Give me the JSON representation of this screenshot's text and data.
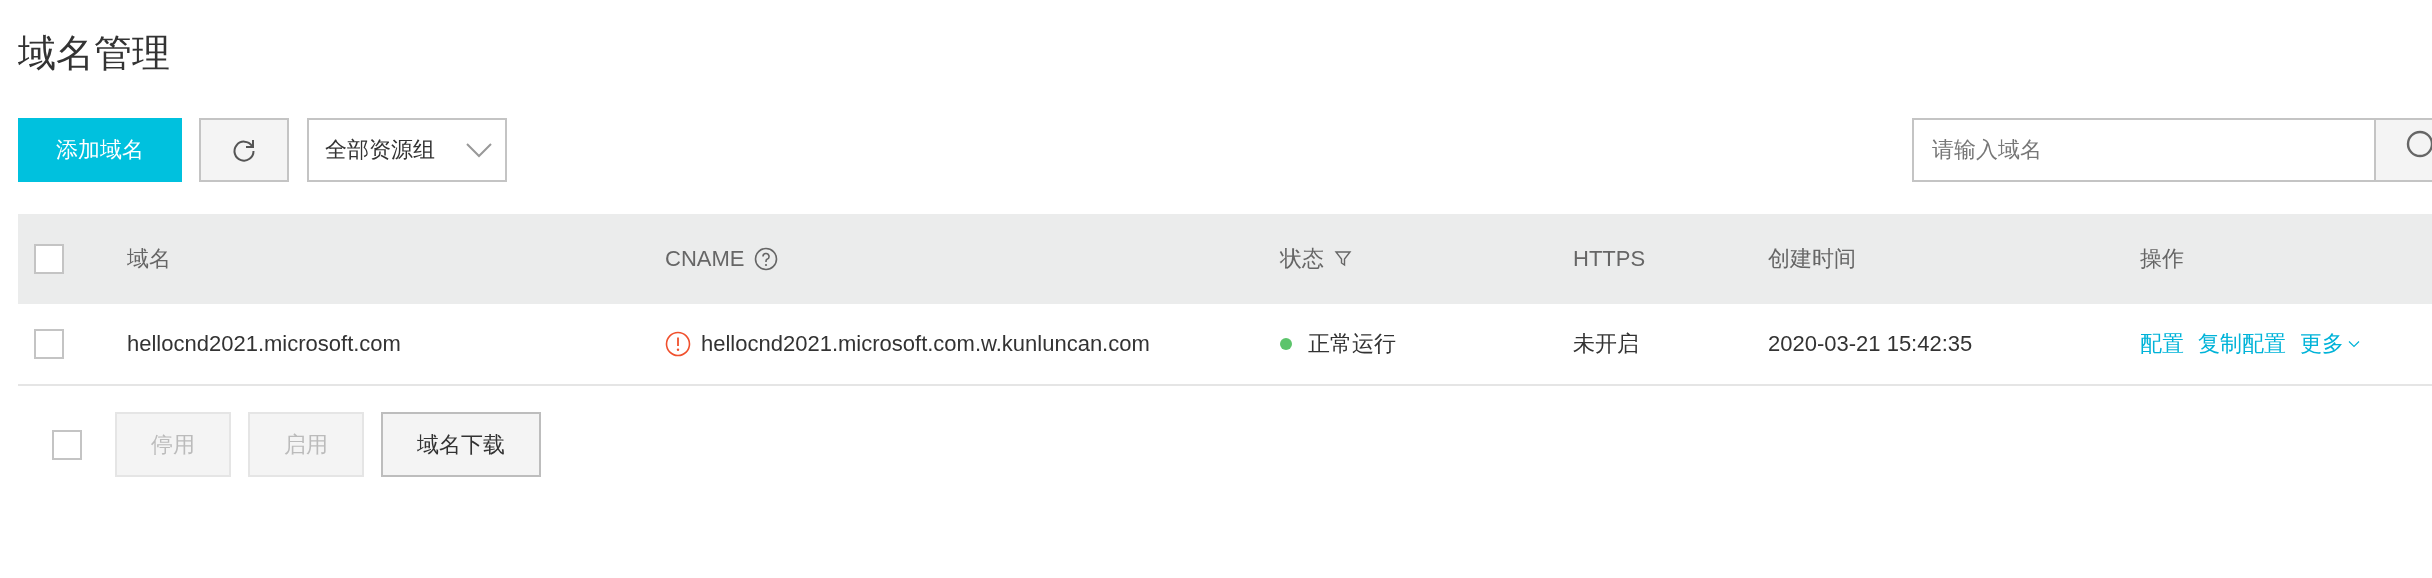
{
  "title": "域名管理",
  "toolbar": {
    "add_button": "添加域名",
    "resource_group": "全部资源组",
    "search": {
      "placeholder": "请输入域名"
    }
  },
  "table": {
    "select_all_checked": false,
    "columns": [
      {
        "label": "域名",
        "kind": "text"
      },
      {
        "label": "CNAME",
        "kind": "help"
      },
      {
        "label": "状态",
        "kind": "filter"
      },
      {
        "label": "HTTPS",
        "kind": "text"
      },
      {
        "label": "创建时间",
        "kind": "text"
      },
      {
        "label": "操作",
        "kind": "text"
      }
    ],
    "rows": [
      {
        "checked": false,
        "domain": "hellocnd2021.microsoft.com",
        "cname": "hellocnd2021.microsoft.com.w.kunluncan.com",
        "cname_warning": true,
        "status": "正常运行",
        "color": "#5cc46b",
        "https": "未开启",
        "created": "2020-03-21 15:42:35",
        "actions": [
          {
            "label": "配置",
            "dropdown": false
          },
          {
            "label": "复制配置",
            "dropdown": false
          },
          {
            "label": "更多",
            "dropdown": true
          }
        ]
      }
    ]
  },
  "footer": {
    "select_all_checked": false,
    "buttons": [
      {
        "label": "停用",
        "disabled": true
      },
      {
        "label": "启用",
        "disabled": true
      },
      {
        "label": "域名下载",
        "disabled": false
      }
    ]
  }
}
